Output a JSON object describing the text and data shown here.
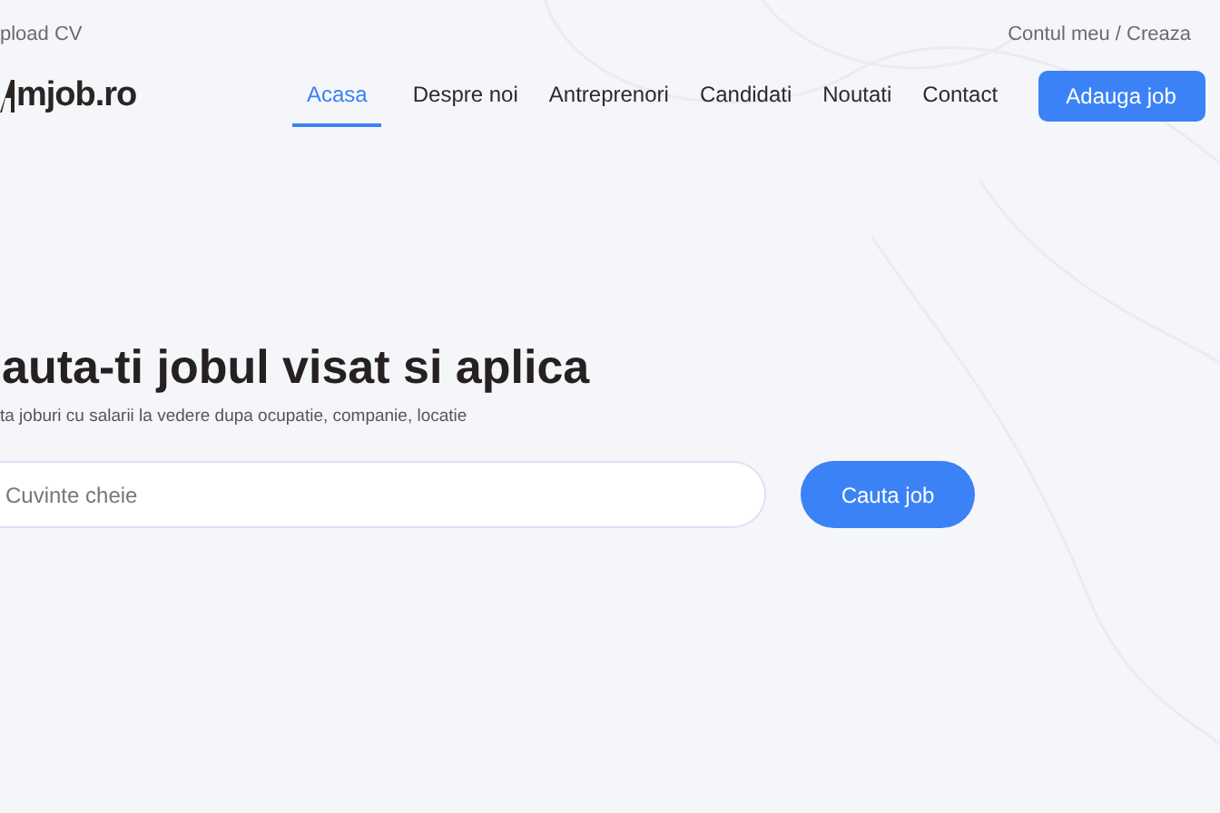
{
  "top_bar": {
    "left_link": "pload CV",
    "right_link": "Contul meu / Creaza"
  },
  "header": {
    "logo": "mjob.ro",
    "nav": [
      {
        "label": "Acasa",
        "selected": true
      },
      {
        "label": "Despre noi",
        "selected": false
      },
      {
        "label": "Antreprenori",
        "selected": false
      },
      {
        "label": "Candidati",
        "selected": false
      },
      {
        "label": "Noutati",
        "selected": false
      },
      {
        "label": "Contact",
        "selected": false
      }
    ],
    "cta_button": "Adauga job"
  },
  "hero": {
    "title": "auta-ti jobul visat si aplica",
    "subtitle": "ta joburi cu salarii la vedere dupa ocupatie, companie, locatie",
    "search": {
      "placeholder": "Cuvinte cheie"
    },
    "search_button": "Cauta job"
  }
}
